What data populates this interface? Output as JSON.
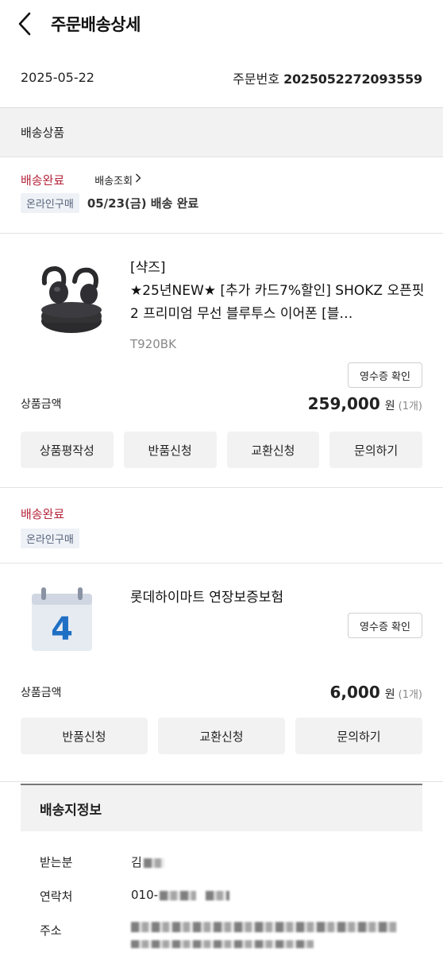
{
  "header": {
    "title": "주문배송상세",
    "back_icon": "chevron-left-icon"
  },
  "order": {
    "date": "2025-05-22",
    "number_label": "주문번호",
    "number": "2025052272093559"
  },
  "section_title": "배송상품",
  "group1": {
    "status": "배송완료",
    "track_label": "배송조회",
    "chip": "온라인구매",
    "delivery_date": "05/23(금) 배송 완료"
  },
  "product1": {
    "brand": "[샥즈]",
    "name": "★25년NEW★ [추가 카드7%할인] SHOKZ 오픈핏2 프리미엄 무선 블루투스 이어폰 [블…",
    "option": "T920BK",
    "receipt": "영수증 확인",
    "price_label": "상품금액",
    "price": "259,000",
    "currency": "원",
    "qty": "(1개)",
    "buttons": [
      "상품평작성",
      "반품신청",
      "교환신청",
      "문의하기"
    ]
  },
  "group2": {
    "status": "배송완료",
    "chip": "온라인구매"
  },
  "product2": {
    "name": "롯데하이마트 연장보증보험",
    "calendar_number": "4",
    "receipt": "영수증 확인",
    "price_label": "상품금액",
    "price": "6,000",
    "currency": "원",
    "qty": "(1개)",
    "buttons": [
      "반품신청",
      "교환신청",
      "문의하기"
    ]
  },
  "shipping": {
    "title": "배송지정보",
    "recipient_label": "받는분",
    "recipient": "김",
    "phone_label": "연락처",
    "phone": "010-",
    "address_label": "주소"
  },
  "colors": {
    "status_red": "#b5243a",
    "chip_bg": "#eef1f6",
    "calendar_blue": "#1f6fc4"
  }
}
